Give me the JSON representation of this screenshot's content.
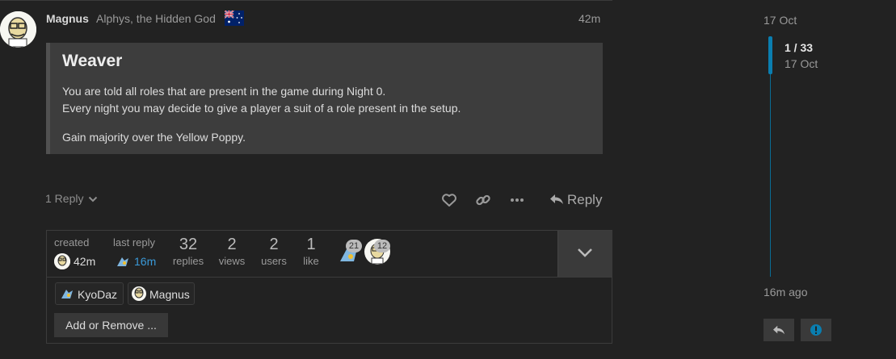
{
  "post": {
    "username": "Magnus",
    "user_title": "Alphys, the Hidden God",
    "flag_icon": "australia-flag-icon",
    "time": "42m",
    "quote": {
      "title": "Weaver",
      "line1": "You are told all roles that are present in the game during Night 0.",
      "line2": "Every night you may decide to give a player a suit of a role present in the setup.",
      "line3": "Gain majority over the Yellow Poppy."
    },
    "actions": {
      "replies_toggle": "1 Reply",
      "like_icon": "heart-icon",
      "link_icon": "link-icon",
      "more_icon": "ellipsis-icon",
      "reply_label": "Reply"
    }
  },
  "topic_map": {
    "created_label": "created",
    "created_time": "42m",
    "last_reply_label": "last reply",
    "last_reply_time": "16m",
    "stats": [
      {
        "num": "32",
        "label": "replies"
      },
      {
        "num": "2",
        "label": "views"
      },
      {
        "num": "2",
        "label": "users"
      },
      {
        "num": "1",
        "label": "like"
      }
    ],
    "participants": [
      {
        "count": "21"
      },
      {
        "count": "12"
      }
    ],
    "users": [
      {
        "name": "KyoDaz"
      },
      {
        "name": "Magnus"
      }
    ],
    "add_remove_label": "Add or Remove ..."
  },
  "timeline": {
    "top_date": "17 Oct",
    "counter": "1 / 33",
    "counter_date": "17 Oct",
    "bottom_label": "16m ago"
  },
  "colors": {
    "background": "#222222",
    "accent": "#0a7eb0",
    "quote_bg": "#3d3d3d"
  }
}
